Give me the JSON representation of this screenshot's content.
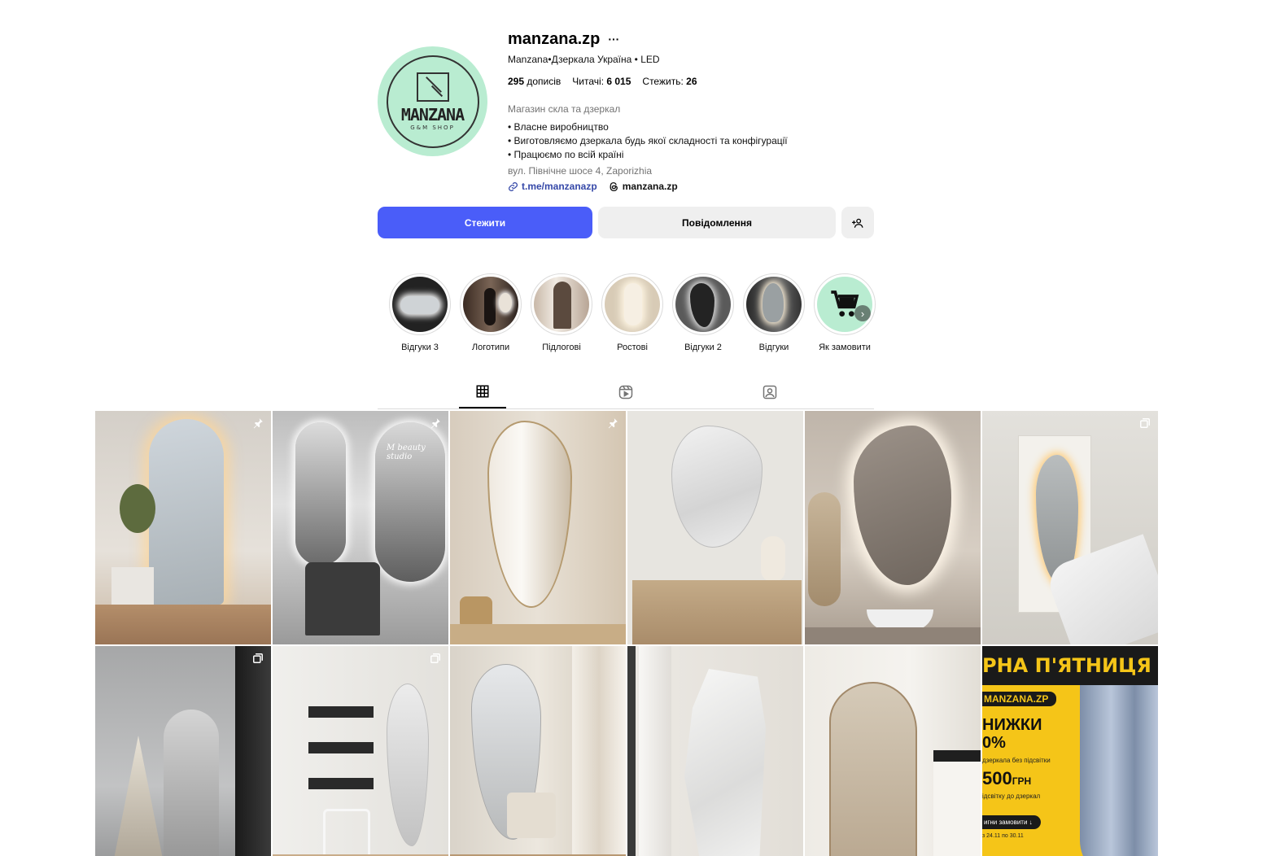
{
  "profile": {
    "username": "manzana.zp",
    "more_icon": "more-icon",
    "full_name": "Manzana•Дзеркала Україна • LED",
    "avatar": {
      "logo_name": "MANZANA",
      "logo_sub": "G&M SHOP",
      "bg_color": "#b9ecd1"
    },
    "stats": {
      "posts_value": "295",
      "posts_label": "дописів",
      "followers_label": "Читачі:",
      "followers_value": "6 015",
      "following_label": "Стежить:",
      "following_value": "26"
    },
    "category": "Магазин скла та дзеркал",
    "bio": [
      "• Власне виробництво",
      "• Виготовляємо дзеркала будь якої складності та конфігурації",
      "• Працюємо по всій країні"
    ],
    "address": "вул. Північне шосе 4, Zaporizhia",
    "link": "t.me/manzanazp",
    "threads": "manzana.zp"
  },
  "actions": {
    "follow_label": "Стежити",
    "message_label": "Повідомлення",
    "add_user_icon": "add-user-icon",
    "follow_color": "#4a5df9"
  },
  "highlights": [
    {
      "label": "Відгуки 3"
    },
    {
      "label": "Логотипи"
    },
    {
      "label": "Підлогові"
    },
    {
      "label": "Ростові"
    },
    {
      "label": "Відгуки 2"
    },
    {
      "label": "Відгуки"
    },
    {
      "label": "Як замовити"
    }
  ],
  "tabs": [
    {
      "icon": "grid-icon",
      "active": true
    },
    {
      "icon": "reels-icon",
      "active": false
    },
    {
      "icon": "tagged-icon",
      "active": false
    }
  ],
  "posts": [
    {
      "badge": "pin-icon",
      "logo_text": ""
    },
    {
      "badge": "pin-icon",
      "logo_text": "M beauty studio"
    },
    {
      "badge": "pin-icon",
      "logo_text": ""
    },
    {
      "badge": "",
      "logo_text": ""
    },
    {
      "badge": "",
      "logo_text": ""
    },
    {
      "badge": "carousel-icon",
      "logo_text": ""
    },
    {
      "badge": "carousel-icon",
      "logo_text": ""
    },
    {
      "badge": "carousel-icon",
      "logo_text": ""
    },
    {
      "badge": "",
      "logo_text": ""
    },
    {
      "badge": "",
      "logo_text": ""
    },
    {
      "badge": "",
      "logo_text": ""
    },
    {
      "badge": "",
      "logo_text": ""
    }
  ],
  "promo": {
    "headline": "РНА П'ЯТНИЦЯ",
    "tag": "MANZANA.ZP",
    "discount_line1": "НИЖКИ",
    "discount_line2": "0%",
    "discount_note": "дзеркала без підсвітки",
    "price": "500",
    "price_unit": "ГРН",
    "price_note": "ідсвітку до дзеркал",
    "cta": "игни замовити ↓",
    "dates": "з 24.11 по 30.11",
    "accent_color": "#f5c518"
  }
}
